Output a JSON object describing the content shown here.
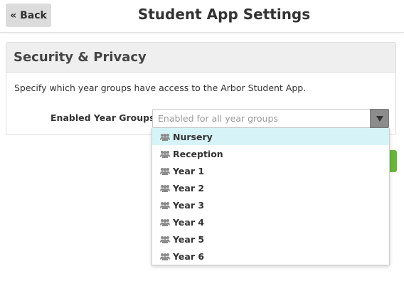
{
  "header": {
    "back_label": "« Back",
    "title": "Student App Settings"
  },
  "section": {
    "title": "Security & Privacy",
    "description": "Specify which year groups have access to the Arbor Student App.",
    "field_label": "Enabled Year Groups",
    "select_placeholder": "Enabled for all year groups"
  },
  "dropdown": {
    "highlighted_index": 0,
    "options": [
      {
        "label": "Nursery",
        "icon": "group-icon"
      },
      {
        "label": "Reception",
        "icon": "group-icon"
      },
      {
        "label": "Year 1",
        "icon": "group-icon"
      },
      {
        "label": "Year 2",
        "icon": "group-icon"
      },
      {
        "label": "Year 3",
        "icon": "group-icon"
      },
      {
        "label": "Year 4",
        "icon": "group-icon"
      },
      {
        "label": "Year 5",
        "icon": "group-icon"
      },
      {
        "label": "Year 6",
        "icon": "group-icon"
      }
    ]
  },
  "colors": {
    "highlight": "#d6f3f8",
    "accent_green": "#6bb43f",
    "header_bg": "#efefef"
  }
}
